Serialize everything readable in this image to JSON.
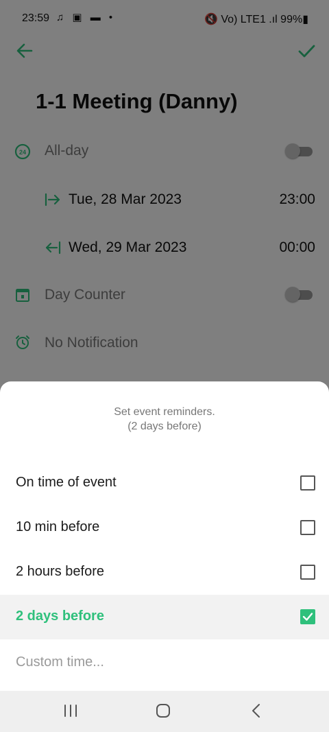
{
  "status_bar": {
    "time": "23:59",
    "left_icons": "♫ ▣ ▬ •",
    "right_text": "🔇 Vo) LTE1 .ıl 99%▮"
  },
  "header": {
    "title": "1-1 Meeting (Danny)"
  },
  "event": {
    "all_day_label": "All-day",
    "start_date": "Tue, 28 Mar 2023",
    "start_time": "23:00",
    "end_date": "Wed, 29 Mar 2023",
    "end_time": "00:00",
    "day_counter_label": "Day Counter",
    "notification_label": "No Notification"
  },
  "sheet": {
    "title_line1": "Set event reminders.",
    "title_line2": "(2 days before)",
    "options": [
      {
        "label": "On time of event",
        "checked": false
      },
      {
        "label": "10 min before",
        "checked": false
      },
      {
        "label": "2 hours before",
        "checked": false
      },
      {
        "label": "2 days before",
        "checked": true
      }
    ],
    "custom_label": "Custom time..."
  },
  "colors": {
    "accent": "#2fc07c"
  }
}
